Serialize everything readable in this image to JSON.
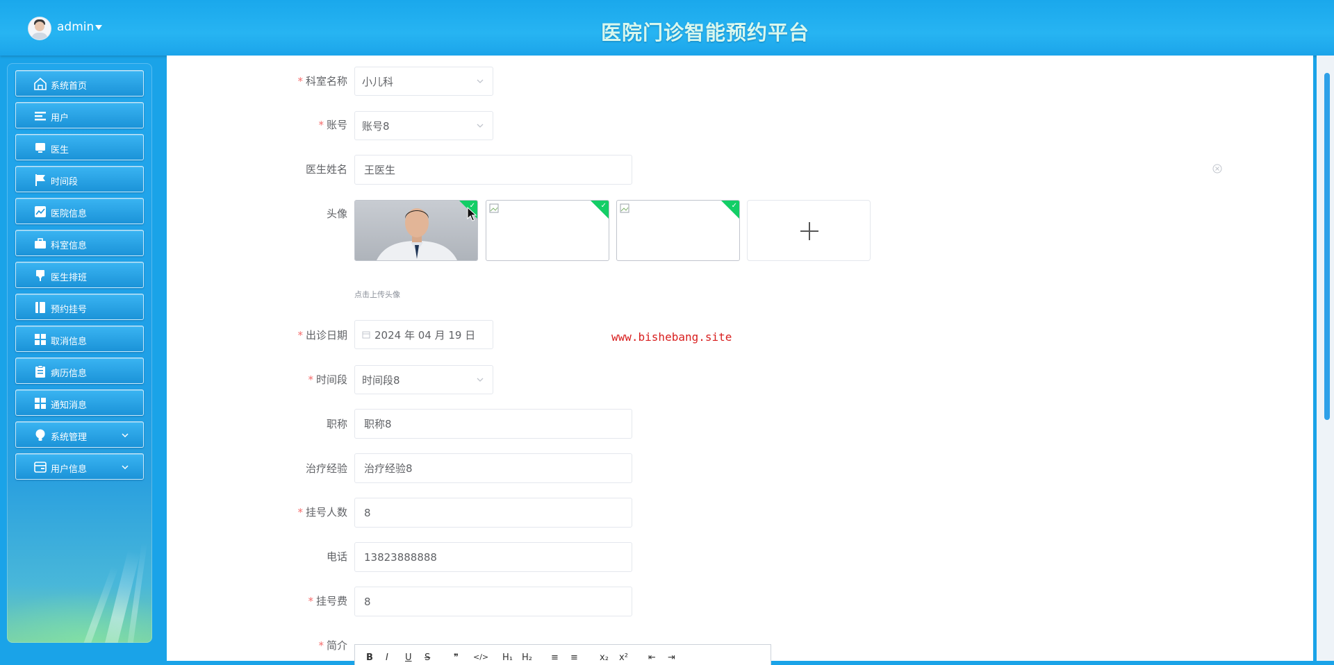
{
  "header": {
    "username": "admin",
    "app_title": "医院门诊智能预约平台"
  },
  "sidebar": {
    "items": [
      {
        "label": "系统首页",
        "icon": "home-icon"
      },
      {
        "label": "用户",
        "icon": "list-icon"
      },
      {
        "label": "医生",
        "icon": "monitor-icon"
      },
      {
        "label": "时间段",
        "icon": "flag-icon"
      },
      {
        "label": "医院信息",
        "icon": "chart-icon"
      },
      {
        "label": "科室信息",
        "icon": "briefcase-icon"
      },
      {
        "label": "医生排班",
        "icon": "marker-icon"
      },
      {
        "label": "预约挂号",
        "icon": "book-icon"
      },
      {
        "label": "取消信息",
        "icon": "grid-icon"
      },
      {
        "label": "病历信息",
        "icon": "clipboard-icon"
      },
      {
        "label": "通知消息",
        "icon": "grid-icon"
      },
      {
        "label": "系统管理",
        "icon": "bulb-icon"
      },
      {
        "label": "用户信息",
        "icon": "wallet-icon"
      }
    ]
  },
  "form": {
    "department": {
      "label": "科室名称",
      "value": "小儿科"
    },
    "account": {
      "label": "账号",
      "value": "账号8"
    },
    "doctor_name": {
      "label": "医生姓名",
      "value": "王医生"
    },
    "avatar": {
      "label": "头像",
      "hint": "点击上传头像"
    },
    "visit_date": {
      "label": "出诊日期",
      "value": "2024 年 04 月 19 日"
    },
    "time_slot": {
      "label": "时间段",
      "value": "时间段8"
    },
    "title": {
      "label": "职称",
      "value": "职称8"
    },
    "experience": {
      "label": "治疗经验",
      "value": "治疗经验8"
    },
    "quota": {
      "label": "挂号人数",
      "value": "8"
    },
    "phone": {
      "label": "电话",
      "value": "13823888888"
    },
    "fee": {
      "label": "挂号费",
      "value": "8"
    },
    "intro": {
      "label": "简介"
    }
  },
  "watermark": "www.bishebang.site",
  "editor_toolbar": [
    "B",
    "I",
    "U",
    "S",
    "❞",
    "</>",
    "H₁",
    "H₂",
    "≡",
    "≡",
    "x₂",
    "x²",
    "⇤",
    "⇥"
  ],
  "colors": {
    "accent": "#1aa3e8",
    "required": "#f56c6c",
    "success": "#13ce66"
  }
}
